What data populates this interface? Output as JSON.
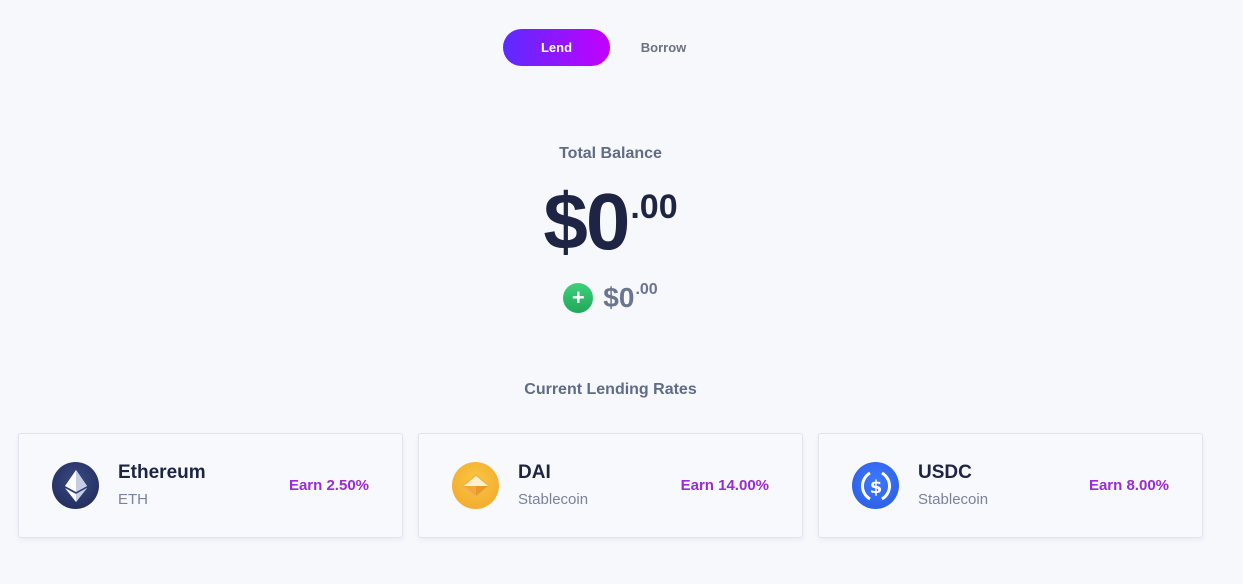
{
  "toggle": {
    "lend_label": "Lend",
    "borrow_label": "Borrow"
  },
  "balance": {
    "label": "Total Balance",
    "main": "$0",
    "cents": ".00",
    "sub_main": "$0",
    "sub_cents": ".00",
    "plus_symbol": "+"
  },
  "rates": {
    "title": "Current Lending Rates",
    "cards": [
      {
        "name": "Ethereum",
        "sub": "ETH",
        "earn": "Earn 2.50%",
        "icon": "ethereum-icon"
      },
      {
        "name": "DAI",
        "sub": "Stablecoin",
        "earn": "Earn 14.00%",
        "icon": "dai-icon"
      },
      {
        "name": "USDC",
        "sub": "Stablecoin",
        "earn": "Earn 8.00%",
        "icon": "usdc-icon"
      }
    ]
  },
  "colors": {
    "accent_start": "#5b2cff",
    "accent_end": "#c300ff",
    "earn": "#9b2ad8",
    "positive": "#1fa85a",
    "text_dark": "#1e2444"
  }
}
